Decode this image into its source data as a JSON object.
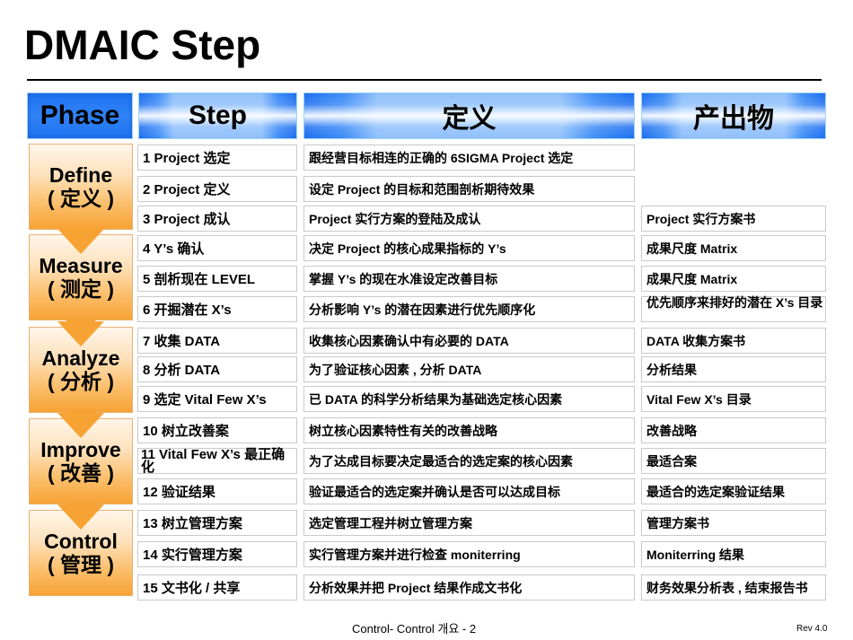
{
  "title": "DMAIC Step",
  "headers": {
    "phase": "Phase",
    "step": "Step",
    "definition": "定义",
    "output": "产出物"
  },
  "phases": [
    {
      "en": "Define",
      "cn": "( 定义 )"
    },
    {
      "en": "Measure",
      "cn": "( 测定 )"
    },
    {
      "en": "Analyze",
      "cn": "( 分析 )"
    },
    {
      "en": "Improve",
      "cn": "( 改善 )"
    },
    {
      "en": "Control",
      "cn": "( 管理 )"
    }
  ],
  "rows": [
    {
      "step": "1 Project 选定",
      "definition": "跟经营目标相连的正确的 6SIGMA Project 选定",
      "output": ""
    },
    {
      "step": "2 Project 定义",
      "definition": "设定 Project 的目标和范围剖析期待效果",
      "output": ""
    },
    {
      "step": "3 Project 成认",
      "definition": "Project 实行方案的登陆及成认",
      "output": "Project 实行方案书"
    },
    {
      "step": "4 Y’s  确认",
      "definition": "决定 Project 的核心成果指标的 Y’s",
      "output": "成果尺度  Matrix"
    },
    {
      "step": "5  剖析现在 LEVEL",
      "definition": "掌握 Y’s 的现在水准设定改善目标",
      "output": "成果尺度  Matrix"
    },
    {
      "step": "6  开掘潜在 X’s",
      "definition": "分析影响 Y’s 的潜在因素进行优先顺序化",
      "output": "优先顺序来排好的潜在  X’s 目录"
    },
    {
      "step": "7  收集 DATA",
      "definition": "收集核心因素确认中有必要的 DATA",
      "output": "DATA 收集方案书"
    },
    {
      "step": "8  分析 DATA",
      "definition": "为了验证核心因素 , 分析 DATA",
      "output": "分析结果"
    },
    {
      "step": "9  选定 Vital Few X’s",
      "definition": "已 DATA 的科学分析结果为基础选定核心因素",
      "output": "Vital Few X’s  目录"
    },
    {
      "step": "10  树立改善案",
      "definition": "树立核心因素特性有关的改善战略",
      "output": "改善战略"
    },
    {
      "step": "11 Vital Few X’s  最正确化",
      "definition": "为了达成目标要决定最适合的选定案的核心因素",
      "output": "最适合案"
    },
    {
      "step": "12  验证结果",
      "definition": "验证最适合的选定案并确认是否可以达成目标",
      "output": "最适合的选定案验证结果"
    },
    {
      "step": "13  树立管理方案",
      "definition": "选定管理工程并树立管理方案",
      "output": "管理方案书"
    },
    {
      "step": "14  实行管理方案",
      "definition": "实行管理方案并进行检查  moniterring",
      "output": "Moniterring 结果"
    },
    {
      "step": "15  文书化 / 共享",
      "definition": "分析效果并把 Project 结果作成文书化",
      "output": "财务效果分析表 , 结束报告书"
    }
  ],
  "footer": {
    "center": "Control- Control  개요  - 2",
    "revision": "Rev 4.0"
  },
  "colors": {
    "header_blue": "#1f74f2",
    "phase_orange": "#f7a334"
  }
}
